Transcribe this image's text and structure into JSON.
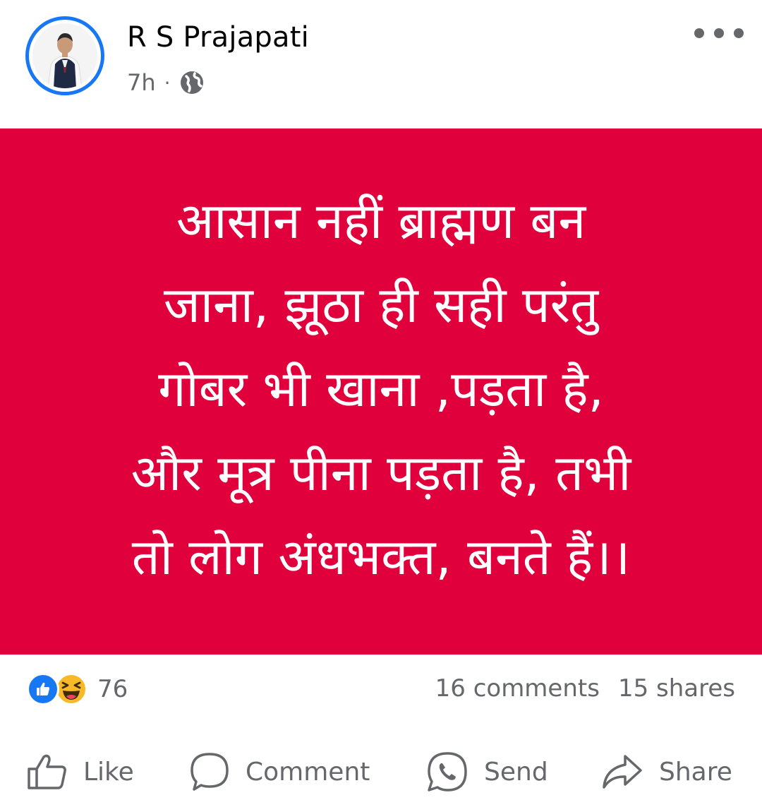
{
  "post": {
    "author": "R S Prajapati",
    "time": "7h",
    "separator": "·",
    "privacy_icon": "globe-icon",
    "text_lines": [
      "आसान नहीं ब्राह्मण बन",
      "जाना, झूठा ही सही परंतु",
      "गोबर भी खाना ,पड़ता है,",
      "और मूत्र पीना पड़ता है, तभी",
      "तो लोग अंधभक्त, बनते हैं।।"
    ],
    "banner_color": "#e0003b"
  },
  "stats": {
    "reaction_count": "76",
    "comments": "16 comments",
    "shares": "15 shares"
  },
  "actions": {
    "like": "Like",
    "comment": "Comment",
    "send": "Send",
    "share": "Share"
  },
  "colors": {
    "accent": "#1877f2",
    "muted": "#65676b"
  }
}
